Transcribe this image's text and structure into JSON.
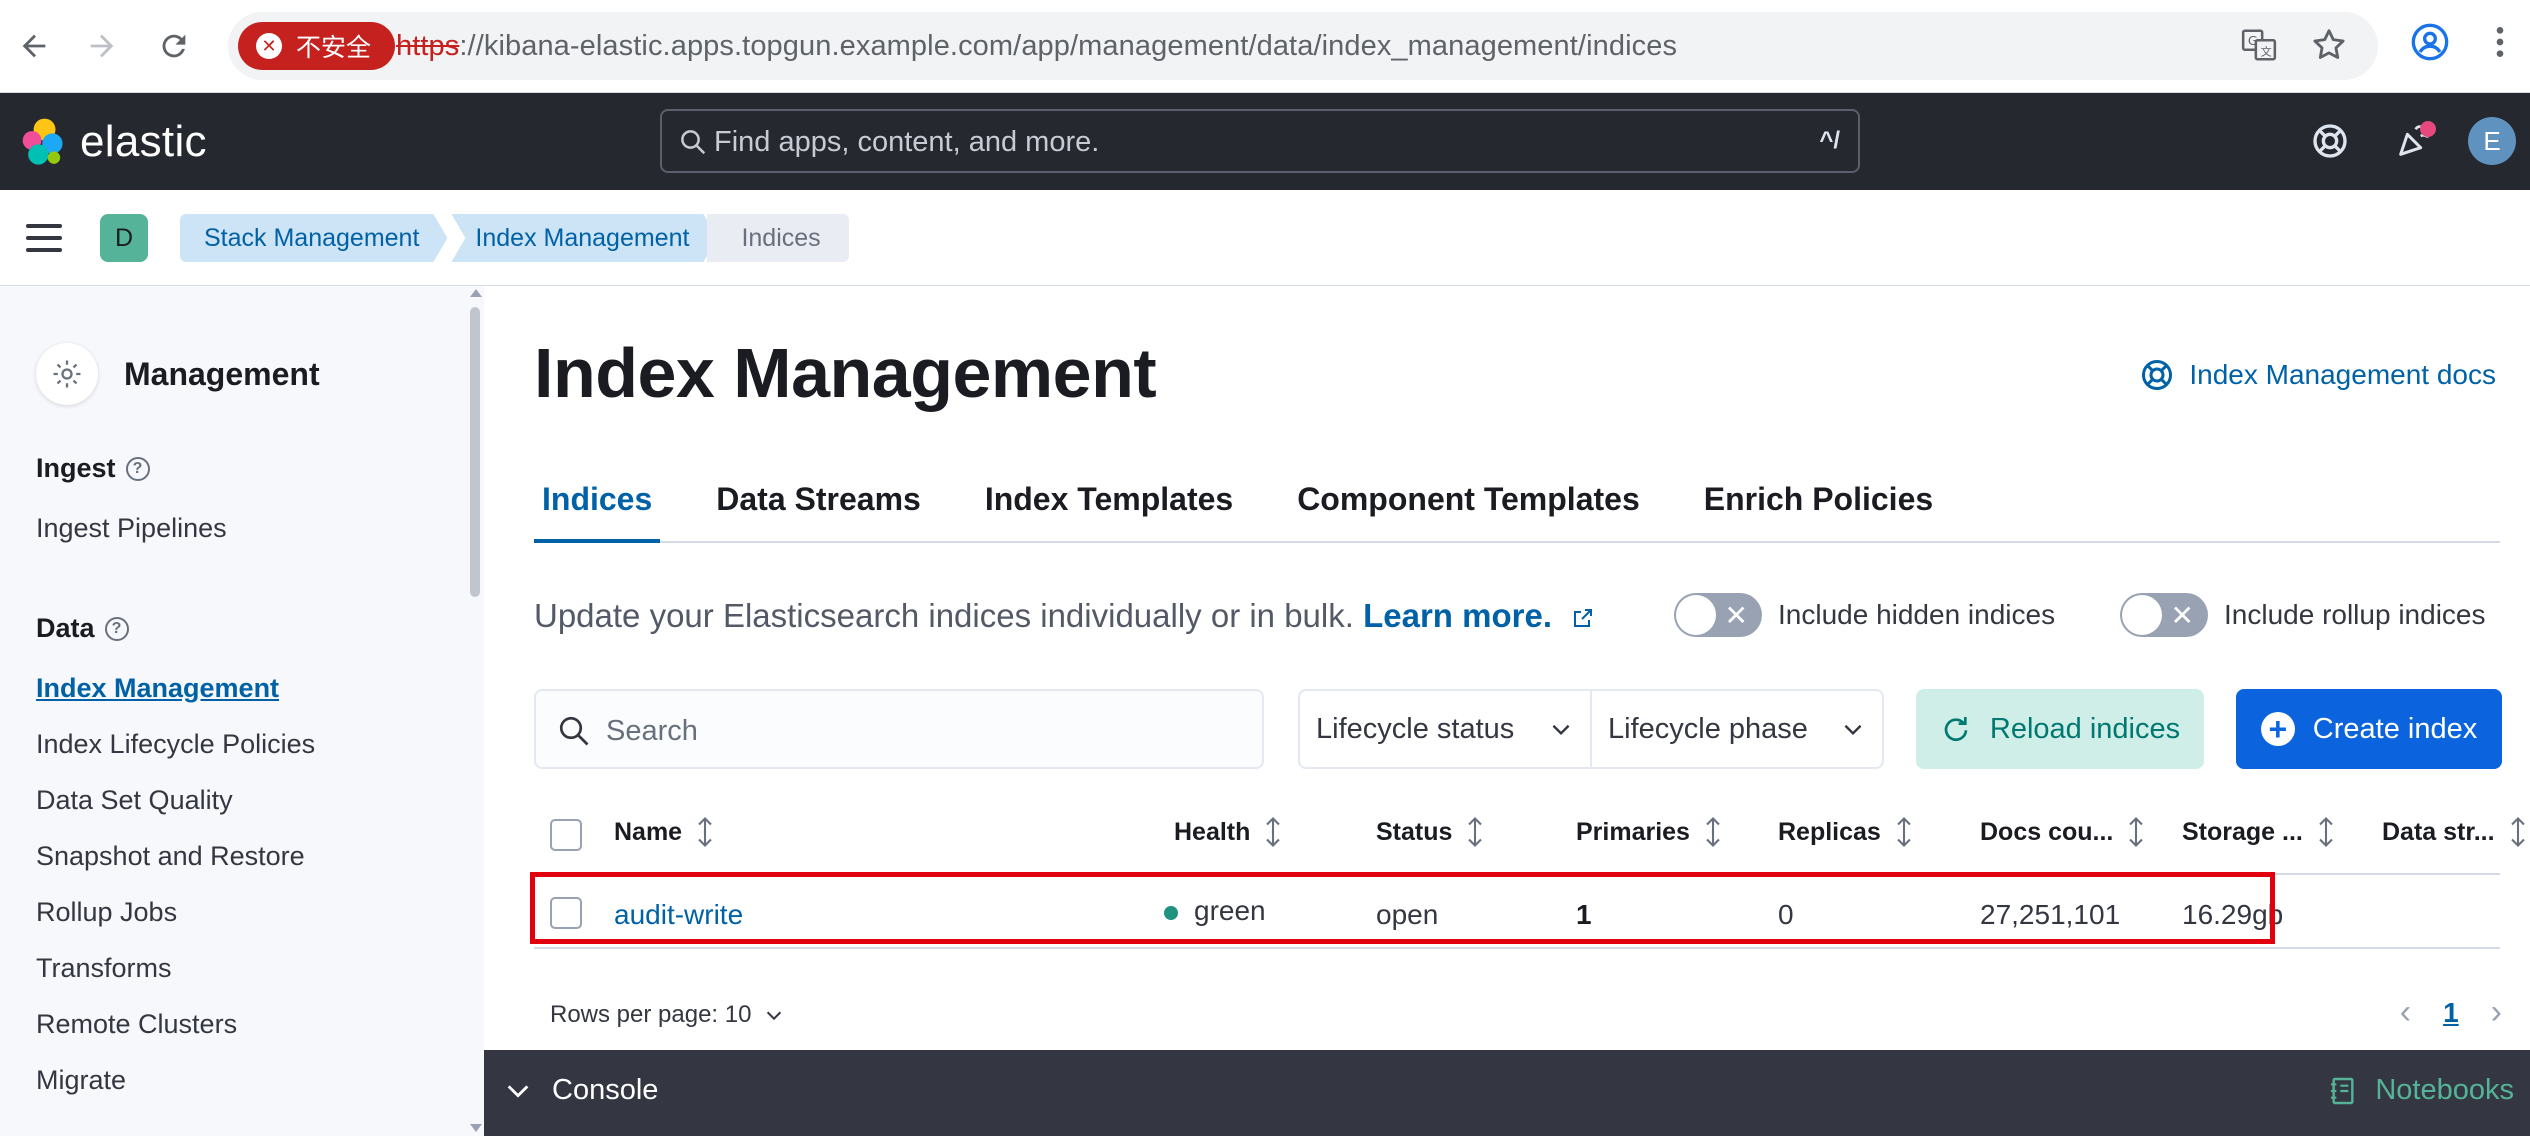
{
  "browser": {
    "insecure_label": "不安全",
    "url_scheme": "https",
    "url_rest": "://kibana-elastic.apps.topgun.example.com/app/management/data/index_management/indices"
  },
  "header": {
    "logo_text": "elastic",
    "search_placeholder": "Find apps, content, and more.",
    "search_shortcut": "^/",
    "avatar_initial": "E"
  },
  "breadcrumb": {
    "space_initial": "D",
    "items": [
      "Stack Management",
      "Index Management",
      "Indices"
    ]
  },
  "sidebar": {
    "title": "Management",
    "sections": [
      {
        "title": "Ingest",
        "items": [
          "Ingest Pipelines"
        ]
      },
      {
        "title": "Data",
        "items": [
          "Index Management",
          "Index Lifecycle Policies",
          "Data Set Quality",
          "Snapshot and Restore",
          "Rollup Jobs",
          "Transforms",
          "Remote Clusters",
          "Migrate"
        ]
      }
    ],
    "active_item": "Index Management"
  },
  "main": {
    "title": "Index Management",
    "docs_link": "Index Management docs",
    "tabs": [
      "Indices",
      "Data Streams",
      "Index Templates",
      "Component Templates",
      "Enrich Policies"
    ],
    "active_tab": "Indices",
    "description": "Update your Elasticsearch indices individually or in bulk.",
    "learn_more": "Learn more.",
    "toggle_hidden": "Include hidden indices",
    "toggle_rollup": "Include rollup indices",
    "search_placeholder": "Search",
    "filter_lifecycle_status": "Lifecycle status",
    "filter_lifecycle_phase": "Lifecycle phase",
    "reload_label": "Reload indices",
    "create_label": "Create index"
  },
  "table": {
    "columns": [
      "Name",
      "Health",
      "Status",
      "Primaries",
      "Replicas",
      "Docs cou...",
      "Storage ...",
      "Data str..."
    ],
    "rows": [
      {
        "name": "audit-write",
        "health": "green",
        "status": "open",
        "primaries": "1",
        "replicas": "0",
        "docs_count": "27,251,101",
        "storage": "16.29gb",
        "data_stream": ""
      }
    ]
  },
  "pagination": {
    "rows_per_page": "Rows per page: 10",
    "current_page": "1"
  },
  "footer": {
    "console_label": "Console",
    "notebooks_label": "Notebooks"
  },
  "colors": {
    "accent": "#0061a6",
    "primary_button": "#0b64dd",
    "reload_bg": "#cfeee7",
    "health_green": "#209280",
    "highlight": "#e3000e",
    "header_bg": "#25282f"
  }
}
